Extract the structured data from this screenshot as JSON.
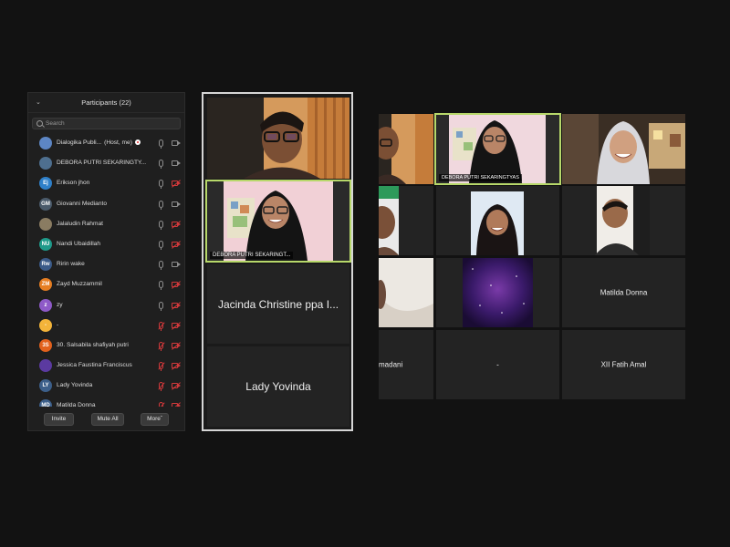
{
  "participants_panel": {
    "title": "Participants (22)",
    "search_placeholder": "Search",
    "rows": [
      {
        "initials": "",
        "name": "Dialogika Publi...",
        "suffix": "(Host, me)",
        "avatar_color": "#5d86c4",
        "mic": "on",
        "cam": "on",
        "recording": true
      },
      {
        "initials": "",
        "name": "DEBORA PUTRI SEKARINGTY...",
        "suffix": "",
        "avatar_color": "#4e6f8f",
        "mic": "on",
        "cam": "on",
        "recording": false
      },
      {
        "initials": "Ej",
        "name": "Erikson jhon",
        "suffix": "",
        "avatar_color": "#2f80c9",
        "mic": "on",
        "cam": "off",
        "recording": false
      },
      {
        "initials": "GM",
        "name": "Giovanni Medianto",
        "suffix": "",
        "avatar_color": "#4a5a6a",
        "mic": "on",
        "cam": "on",
        "recording": false
      },
      {
        "initials": "",
        "name": "Jalaludin Rahmat",
        "suffix": "",
        "avatar_color": "#8a7c62",
        "mic": "on",
        "cam": "off",
        "recording": false
      },
      {
        "initials": "NU",
        "name": "Nandi Ubaidillah",
        "suffix": "",
        "avatar_color": "#1f9a8a",
        "mic": "on",
        "cam": "off",
        "recording": false
      },
      {
        "initials": "Rw",
        "name": "Ririn wake",
        "suffix": "",
        "avatar_color": "#3a5a88",
        "mic": "on",
        "cam": "on",
        "recording": false
      },
      {
        "initials": "ZM",
        "name": "Zayd Muzzammil",
        "suffix": "",
        "avatar_color": "#e67e22",
        "mic": "on",
        "cam": "off",
        "recording": false
      },
      {
        "initials": "z",
        "name": "zy",
        "suffix": "",
        "avatar_color": "#8e5ac8",
        "mic": "on",
        "cam": "off",
        "recording": false
      },
      {
        "initials": "-",
        "name": "-",
        "suffix": "",
        "avatar_color": "#f3b43a",
        "mic": "off",
        "cam": "off",
        "recording": false
      },
      {
        "initials": "3S",
        "name": "30. Salsabila shafiyah putri",
        "suffix": "",
        "avatar_color": "#e2611c",
        "mic": "off",
        "cam": "off",
        "recording": false
      },
      {
        "initials": "",
        "name": "Jessica Faustina Franciscus",
        "suffix": "",
        "avatar_color": "#5b3aa0",
        "mic": "off",
        "cam": "off",
        "recording": false
      },
      {
        "initials": "LY",
        "name": "Lady Yovinda",
        "suffix": "",
        "avatar_color": "#3c5f8a",
        "mic": "off",
        "cam": "off",
        "recording": false
      },
      {
        "initials": "MD",
        "name": "Matilda Donna",
        "suffix": "",
        "avatar_color": "#3c5f8a",
        "mic": "off",
        "cam": "off",
        "recording": false
      }
    ],
    "invite_label": "Invite",
    "mute_all_label": "Mute All",
    "more_label": "More"
  },
  "speaker_column": {
    "tiles": [
      {
        "label": ""
      },
      {
        "label": "DEBORA PUTRI SEKARINGT..."
      },
      {
        "label": "Jacinda Christine ppa I..."
      },
      {
        "label": "Lady Yovinda"
      }
    ]
  },
  "gallery": {
    "name_labels": {
      "debora": "DEBORA PUTRI SEKARINGTYAS",
      "matilda": "Matilda Donna",
      "madani": "madani",
      "dash": "-",
      "fatih": "XII Fatih Amal"
    }
  },
  "colors": {
    "active_speaker_border": "#b7d86a",
    "mic_off": "#d3393b",
    "background": "#121212"
  }
}
